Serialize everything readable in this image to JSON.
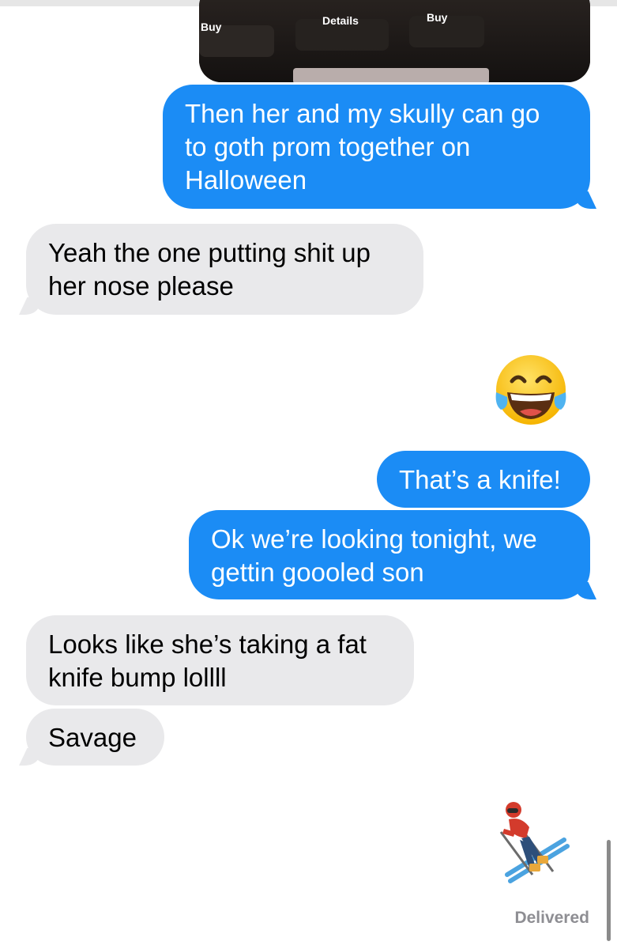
{
  "image_message": {
    "buttons": [
      "Buy",
      "Details",
      "Buy"
    ]
  },
  "messages": [
    {
      "dir": "out",
      "text": "Then her and my skully can go to goth prom together on Halloween"
    },
    {
      "dir": "in",
      "text": "Yeah the one putting shit up her nose please"
    },
    {
      "dir": "out",
      "emoji": "face-with-tears-of-joy"
    },
    {
      "dir": "out",
      "text": "That’s a knife!"
    },
    {
      "dir": "out",
      "text": "Ok we’re looking tonight, we gettin goooled son"
    },
    {
      "dir": "in",
      "text": "Looks like she’s taking a fat knife bump lollll"
    },
    {
      "dir": "in",
      "text": "Savage"
    },
    {
      "dir": "out",
      "emoji": "skier"
    }
  ],
  "status": {
    "delivered": "Delivered"
  },
  "colors": {
    "outgoing": "#1b8cf5",
    "incoming": "#e9e9eb",
    "status": "#8e8e93"
  }
}
